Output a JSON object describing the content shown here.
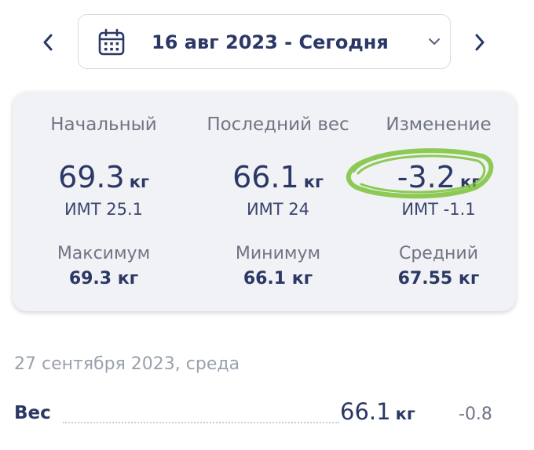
{
  "header": {
    "date_range": "16 авг 2023 - Сегодня",
    "prev_icon": "chevron-left-icon",
    "next_icon": "chevron-right-icon",
    "calendar_icon": "calendar-icon",
    "dropdown_icon": "chevron-down-icon",
    "accent_color": "#2b3866"
  },
  "summary": {
    "start": {
      "label": "Начальный",
      "value": "69.3",
      "unit": "кг",
      "bmi": "ИМТ 25.1"
    },
    "latest": {
      "label": "Последний вес",
      "value": "66.1",
      "unit": "кг",
      "bmi": "ИМТ 24"
    },
    "change": {
      "label": "Изменение",
      "value": "-3.2",
      "unit": "кг",
      "bmi": "ИМТ -1.1",
      "highlight_color": "#7cc23a"
    },
    "max": {
      "label": "Максимум",
      "value": "69.3 кг"
    },
    "min": {
      "label": "Минимум",
      "value": "66.1 кг"
    },
    "avg": {
      "label": "Средний",
      "value": "67.55 кг"
    }
  },
  "entries": {
    "date": "27 сентября 2023, среда",
    "rows": [
      {
        "name": "Вес",
        "value": "66.1",
        "unit": "кг",
        "delta": "-0.8"
      }
    ]
  }
}
